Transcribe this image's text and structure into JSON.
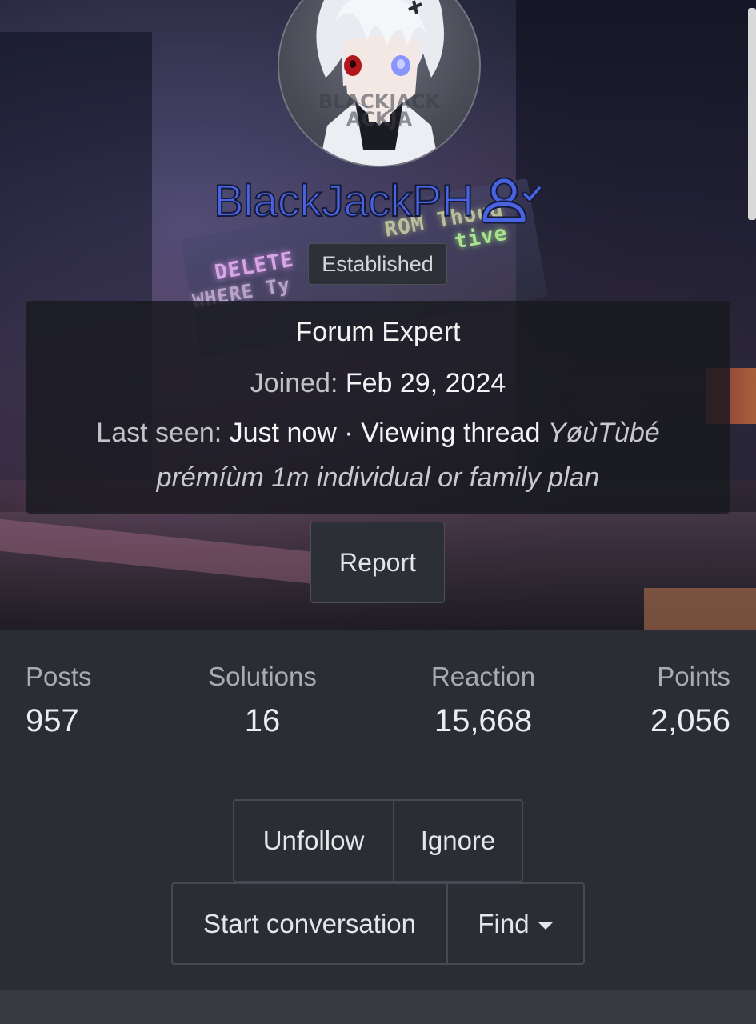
{
  "profile": {
    "username": "BlackJackPH",
    "badge": "Established",
    "rank": "Forum Expert",
    "joined_label": "Joined:",
    "joined_value": "Feb 29, 2024",
    "lastseen_label": "Last seen:",
    "lastseen_value": "Just now",
    "separator": "·",
    "activity": "Viewing thread",
    "thread_title_part1": "YøùTùbé",
    "thread_title_part2": "prémíùm 1m individual or family plan",
    "report_label": "Report",
    "avatar_text_line1": "BLACKJACK",
    "avatar_text_line2": "ACKJA"
  },
  "banner": {
    "neon_delete": "DELETE",
    "neon_where": "WHERE Ty",
    "neon_thought": "ROM Thoug",
    "neon_tive": "tive"
  },
  "stats": [
    {
      "label": "Posts",
      "value": "957"
    },
    {
      "label": "Solutions",
      "value": "16"
    },
    {
      "label": "Reaction",
      "value": "15,668"
    },
    {
      "label": "Points",
      "value": "2,056"
    }
  ],
  "actions": {
    "unfollow": "Unfollow",
    "ignore": "Ignore",
    "start_conversation": "Start conversation",
    "find": "Find"
  },
  "colors": {
    "username": "#4a63e0",
    "page_bg": "#2a2d33"
  },
  "icons": {
    "verified": "user-check-icon",
    "dropdown": "caret-down-icon"
  }
}
